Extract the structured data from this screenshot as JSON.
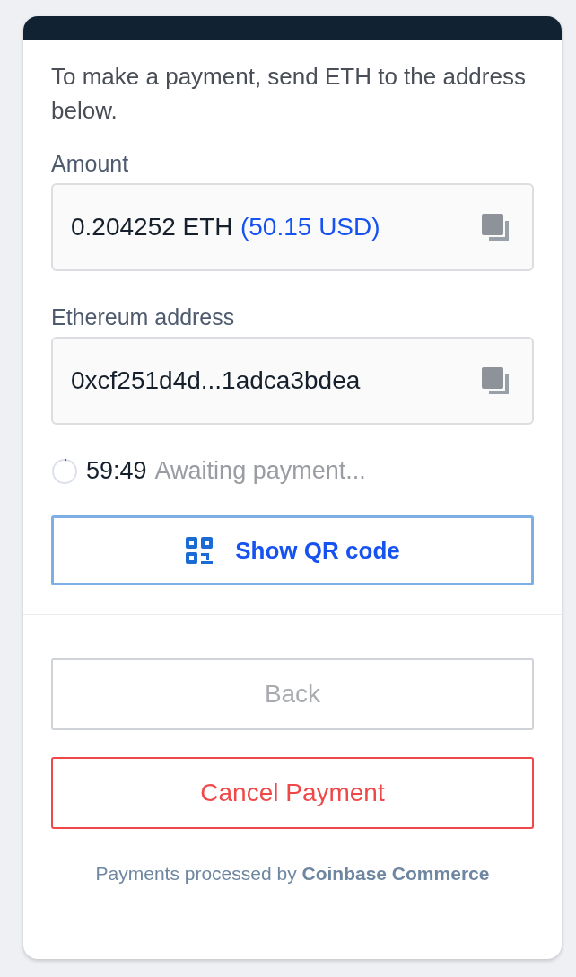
{
  "intro": "To make a payment, send ETH to the address below.",
  "fields": [
    {
      "label": "Amount",
      "value": "0.204252 ETH",
      "extra": "(50.15 USD)"
    },
    {
      "label": "Ethereum address",
      "value": "0xcf251d4d...1adca3bdea"
    }
  ],
  "status": {
    "timer": "59:49",
    "message": "Awaiting payment..."
  },
  "qr_button": "Show QR code",
  "buttons": [
    {
      "label": "Back",
      "kind": "secondary",
      "disabled": true
    },
    {
      "label": "Cancel Payment",
      "kind": "danger",
      "disabled": false
    }
  ],
  "footer": "Payments processed by **Coinbase Commerce**"
}
